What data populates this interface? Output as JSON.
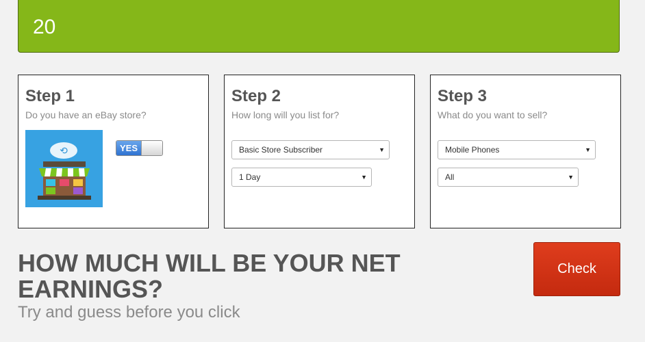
{
  "topbar": {
    "value": "20",
    "color": "#85b719"
  },
  "steps": [
    {
      "title": "Step 1",
      "subtitle": "Do you have an eBay store?",
      "toggle_label": "YES",
      "image_icon": "ebay-store-icon"
    },
    {
      "title": "Step 2",
      "subtitle": "How long will you list for?",
      "select_1": "Basic Store Subscriber",
      "select_2": "1 Day"
    },
    {
      "title": "Step 3",
      "subtitle": "What do you want to sell?",
      "select_1": "Mobile Phones",
      "select_2": "All"
    }
  ],
  "question": "HOW MUCH WILL BE YOUR NET EARNINGS?",
  "hint": "Try and guess before you click",
  "check_label": "Check",
  "check_color": "#d2321a"
}
